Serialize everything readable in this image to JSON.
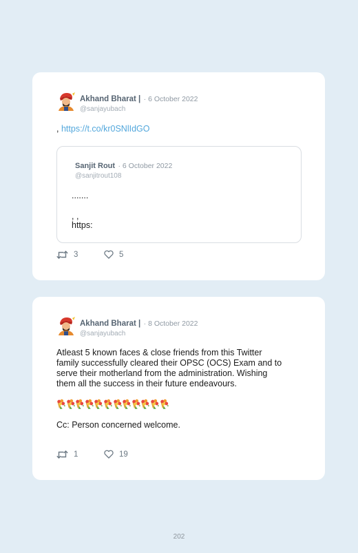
{
  "tweets": [
    {
      "author": "Akhand Bharat |",
      "date": "· 6 October 2022",
      "handle": "@sanjayubach",
      "prefix": ",",
      "link": "https://t.co/kr0SNlIdGO",
      "quote": {
        "author": "Sanjit Rout",
        "date": "· 6 October 2022",
        "handle": "@sanjitrout108",
        "line1": ".......",
        "line2": ", ,",
        "line3": "https:"
      },
      "retweets": "3",
      "likes": "5"
    },
    {
      "author": "Akhand Bharat |",
      "date": "· 8 October 2022",
      "handle": "@sanjayubach",
      "text_lines": [
        "Atleast 5 known faces & close friends from this Twitter",
        "family successfully cleared their OPSC (OCS) Exam and to",
        "serve their motherland from the administration. Wishing",
        "them all the success in their future endeavours."
      ],
      "emoji": "bouquet-emoji",
      "emoji_count": 12,
      "cc": "Cc: Person concerned welcome.",
      "retweets": "1",
      "likes": "19"
    }
  ],
  "page_number": "202",
  "colors": {
    "background": "#e2edf5",
    "card": "#ffffff",
    "link": "#52a7dc",
    "name": "#566472",
    "muted": "#8f99a3"
  },
  "icons": [
    "avatar",
    "retweet-icon",
    "heart-icon",
    "bouquet-emoji"
  ]
}
